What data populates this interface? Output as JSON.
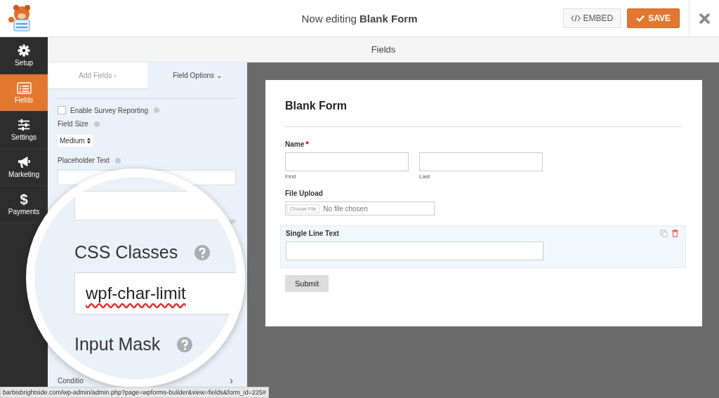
{
  "header": {
    "title": "Now editing **Blank Form**",
    "embed": "EMBED",
    "save": "SAVE"
  },
  "sidebar": {
    "items": [
      {
        "label": "Setup",
        "kind": "gear",
        "selected": false
      },
      {
        "label": "Fields",
        "kind": "list",
        "selected": true
      },
      {
        "label": "Settings",
        "kind": "sliders",
        "selected": false
      },
      {
        "label": "Marketing",
        "kind": "megaphone",
        "selected": false
      },
      {
        "label": "Payments",
        "kind": "dollar",
        "glyph": "$",
        "selected": false
      }
    ]
  },
  "section_title": "Fields",
  "panel": {
    "tabs": [
      {
        "label": "Add Fields",
        "caret": "›",
        "selected": false
      },
      {
        "label": "Field Options",
        "caret": "⌄",
        "selected": true
      }
    ],
    "survey": {
      "label": "Enable Survey Reporting",
      "checked": false
    },
    "field_size": {
      "label": "Field Size",
      "value": "Medium"
    },
    "placeholder": {
      "label": "Placeholder Text"
    },
    "fragment": "gs",
    "conditionals": "Conditio",
    "conditionals_caret": "›"
  },
  "magnifier": {
    "css_label": "CSS Classes",
    "css_value": "wpf-char-limit",
    "mask_label": "Input Mask"
  },
  "form": {
    "title": "Blank Form",
    "fields": [
      {
        "kind": "name",
        "label": "Name",
        "required": true,
        "sublabels": [
          "First",
          "Last"
        ],
        "selected": false
      },
      {
        "kind": "file",
        "label": "File Upload",
        "button": "Choose File",
        "status": "No file chosen",
        "selected": false
      },
      {
        "kind": "text",
        "label": "Single Line Text",
        "selected": true
      }
    ],
    "submit": "Submit"
  },
  "status_bar": "barbisbrightside.com/wp-admin/admin.php?page=wpforms-builder&view=fields&form_id=225#"
}
